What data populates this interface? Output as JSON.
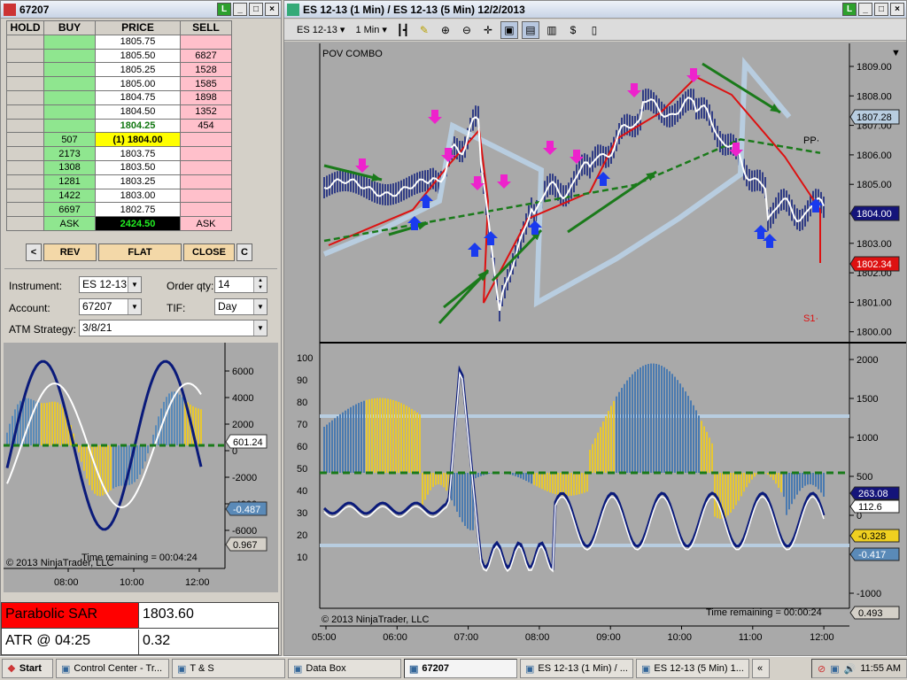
{
  "dom": {
    "title": "67207",
    "headers": {
      "hold": "HOLD",
      "buy": "BUY",
      "price": "PRICE",
      "sell": "SELL"
    },
    "rows": [
      {
        "buy": "",
        "price": "1805.75",
        "sell": "",
        "pc": "#fff",
        "bc": "#8fe68f",
        "sc": "#ffc0cb"
      },
      {
        "buy": "",
        "price": "1805.50",
        "sell": "6827",
        "pc": "#fff",
        "bc": "#8fe68f",
        "sc": "#ffc0cb"
      },
      {
        "buy": "",
        "price": "1805.25",
        "sell": "1528",
        "pc": "#fff",
        "bc": "#8fe68f",
        "sc": "#ffc0cb"
      },
      {
        "buy": "",
        "price": "1805.00",
        "sell": "1585",
        "pc": "#fff",
        "bc": "#8fe68f",
        "sc": "#ffc0cb"
      },
      {
        "buy": "",
        "price": "1804.75",
        "sell": "1898",
        "pc": "#fff",
        "bc": "#8fe68f",
        "sc": "#ffc0cb"
      },
      {
        "buy": "",
        "price": "1804.50",
        "sell": "1352",
        "pc": "#fff",
        "bc": "#8fe68f",
        "sc": "#ffc0cb"
      },
      {
        "buy": "",
        "price": "1804.25",
        "sell": "454",
        "pc": "#fff",
        "bc": "#8fe68f",
        "sc": "#ffc0cb",
        "pcolor": "#117711",
        "bold": true
      },
      {
        "buy": "507",
        "price": "(1) 1804.00",
        "sell": "",
        "pc": "#ffff00",
        "bc": "#8fe68f",
        "sc": "#ffc0cb",
        "bold": true
      },
      {
        "buy": "2173",
        "price": "1803.75",
        "sell": "",
        "pc": "#fff",
        "bc": "#8fe68f",
        "sc": "#ffc0cb"
      },
      {
        "buy": "1308",
        "price": "1803.50",
        "sell": "",
        "pc": "#fff",
        "bc": "#8fe68f",
        "sc": "#ffc0cb"
      },
      {
        "buy": "1281",
        "price": "1803.25",
        "sell": "",
        "pc": "#fff",
        "bc": "#8fe68f",
        "sc": "#ffc0cb"
      },
      {
        "buy": "1422",
        "price": "1803.00",
        "sell": "",
        "pc": "#fff",
        "bc": "#8fe68f",
        "sc": "#ffc0cb"
      },
      {
        "buy": "6697",
        "price": "1802.75",
        "sell": "",
        "pc": "#fff",
        "bc": "#8fe68f",
        "sc": "#ffc0cb"
      },
      {
        "buy": "ASK",
        "price": "2424.50",
        "sell": "ASK",
        "pc": "#000",
        "bc": "#8fe68f",
        "sc": "#ffc0cb",
        "pcolor": "#22ee22",
        "bold": true
      }
    ],
    "buttons": {
      "left": "<",
      "rev": "REV",
      "flat": "FLAT",
      "close": "CLOSE",
      "c": "C"
    },
    "form": {
      "instrument_label": "Instrument:",
      "instrument": "ES 12-13",
      "orderqty_label": "Order qty:",
      "orderqty": "14",
      "account_label": "Account:",
      "account": "67207",
      "tif_label": "TIF:",
      "tif": "Day",
      "atm_label": "ATM Strategy:",
      "atm": "3/8/21"
    },
    "mini_chart": {
      "y_ticks": [
        "6000",
        "4000",
        "2000",
        "0",
        "-2000",
        "-4000",
        "-6000"
      ],
      "x_ticks": [
        "08:00",
        "10:00",
        "12:00"
      ],
      "badges": [
        "601.24",
        "-0.487",
        "0.967"
      ],
      "time_remaining": "Time remaining = 00:04:24",
      "copyright": "© 2013 NinjaTrader, LLC"
    },
    "market_analyzer": [
      {
        "label": "Parabolic SAR",
        "value": "1803.60"
      },
      {
        "label": "ATR @ 04:25",
        "value": "0.32"
      }
    ]
  },
  "chart": {
    "title": "ES 12-13 (1 Min) / ES 12-13 (5 Min)  12/2/2013",
    "toolbar": {
      "instrument": "ES 12-13",
      "interval": "1 Min"
    },
    "panel_label": "POV COMBO",
    "price_ticks": [
      "1809.00",
      "1808.00",
      "1807.00",
      "1806.00",
      "1805.00",
      "1804.00",
      "1803.00",
      "1802.00",
      "1801.00",
      "1800.00"
    ],
    "price_badges": [
      {
        "text": "1807.28",
        "bg": "#b8cde0",
        "fg": "#000"
      },
      {
        "text": "1804.00",
        "bg": "#14147a",
        "fg": "#fff"
      },
      {
        "text": "1802.34",
        "bg": "#dd1111",
        "fg": "#fff"
      }
    ],
    "pivot_labels": {
      "pp": "PP·",
      "s1": "S1·"
    },
    "osc_left_ticks": [
      "100",
      "90",
      "80",
      "70",
      "60",
      "50",
      "40",
      "30",
      "20",
      "10"
    ],
    "osc_right_ticks": [
      "2000",
      "1500",
      "1000",
      "500",
      "0",
      "-500",
      "-1000"
    ],
    "osc_badges": [
      {
        "text": "263.08",
        "bg": "#14147a",
        "fg": "#fff"
      },
      {
        "text": "112.6",
        "bg": "#fff",
        "fg": "#000"
      },
      {
        "text": "-0.328",
        "bg": "#f0d020",
        "fg": "#000"
      },
      {
        "text": "-0.417",
        "bg": "#5a8ab8",
        "fg": "#fff"
      },
      {
        "text": "0.493",
        "bg": "#d4d0c8",
        "fg": "#000"
      }
    ],
    "time_remaining": "Time remaining = 00:00:24",
    "copyright": "© 2013 NinjaTrader, LLC",
    "x_ticks": [
      "05:00",
      "06:00",
      "07:00",
      "08:00",
      "09:00",
      "10:00",
      "11:00",
      "12:00"
    ]
  },
  "taskbar": {
    "start": "Start",
    "tasks": [
      {
        "label": "Control Center - Tr...",
        "active": false
      },
      {
        "label": "T & S",
        "active": false
      },
      {
        "label": "Data Box",
        "active": false
      },
      {
        "label": "67207",
        "active": true
      },
      {
        "label": "ES 12-13 (1 Min) / ...",
        "active": false
      },
      {
        "label": "ES 12-13 (5 Min) 1...",
        "active": false
      }
    ],
    "clock": "11:55 AM"
  }
}
